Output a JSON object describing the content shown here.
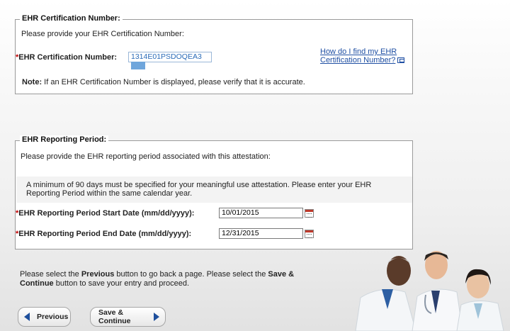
{
  "cert_section": {
    "legend": "EHR Certification Number:",
    "intro": "Please provide your EHR Certification Number:",
    "required_mark": "*",
    "field_label": "EHR Certification Number:",
    "field_value": "1314E01PSDOQEA3",
    "help_link_line1": "How do I find my EHR",
    "help_link_line2": "Certification Number?",
    "note_label": "Note:",
    "note_text": " If an EHR Certification Number is displayed, please verify that it is accurate."
  },
  "period_section": {
    "legend": "EHR Reporting Period:",
    "intro": "Please provide the EHR reporting period associated with this attestation:",
    "notice_line1": "A minimum of 90 days must be specified for your meaningful use attestation. Please enter your EHR",
    "notice_line2": "Reporting Period within the same calendar year.",
    "required_mark": "*",
    "start_label": "EHR Reporting Period Start Date (mm/dd/yyyy):",
    "start_value": "10/01/2015",
    "end_label": "EHR Reporting Period End Date (mm/dd/yyyy):",
    "end_value": "12/31/2015"
  },
  "instructions": {
    "p1": "Please select the ",
    "previous": "Previous",
    "p2": " button to go back a page. Please select the ",
    "save_continue_a": "Save &",
    "save_continue_b": "Continue",
    "p3": " button to save your entry and proceed."
  },
  "buttons": {
    "previous_label": "Previous",
    "save_label": "Save & Continue"
  },
  "colors": {
    "required": "#c00000",
    "link": "#1f4fa3",
    "button_arrow": "#1e4f9c"
  }
}
